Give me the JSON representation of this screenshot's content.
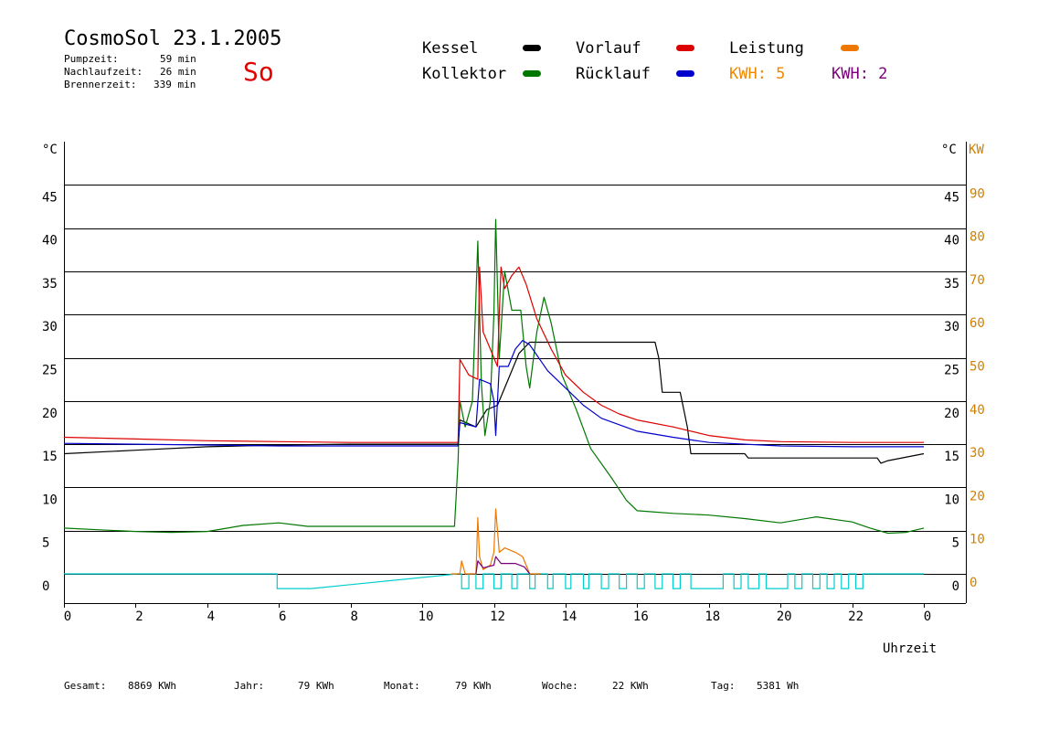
{
  "header": {
    "title": "CosmoSol 23.1.2005",
    "day": "So",
    "stats": [
      {
        "label": "Pumpzeit:",
        "value": "59 min"
      },
      {
        "label": "Nachlaufzeit:",
        "value": "26 min"
      },
      {
        "label": "Brennerzeit:",
        "value": "339 min"
      }
    ]
  },
  "legend": {
    "kessel": {
      "label": "Kessel",
      "color": "#000000"
    },
    "kollektor": {
      "label": "Kollektor",
      "color": "#007700"
    },
    "vorlauf": {
      "label": "Vorlauf",
      "color": "#dd0000"
    },
    "ruecklauf": {
      "label": "Rücklauf",
      "color": "#0000cc"
    },
    "leistung": {
      "label": "Leistung",
      "color": "#ee7700"
    },
    "kwh1": {
      "label": "KWH: 5",
      "color": "#ee8800"
    },
    "kwh2": {
      "label": "KWH: 2",
      "color": "#770077"
    }
  },
  "footer": {
    "gesamt": {
      "label": "Gesamt:",
      "value": "8869 KWh"
    },
    "jahr": {
      "label": "Jahr:",
      "value": "79 KWh"
    },
    "monat": {
      "label": "Monat:",
      "value": "79 KWh"
    },
    "woche": {
      "label": "Woche:",
      "value": "22 KWh"
    },
    "tag": {
      "label": "Tag:",
      "value": "5381 Wh"
    }
  },
  "chart_data": {
    "type": "line",
    "xlabel": "Uhrzeit",
    "ylabel_left": "°C",
    "ylabel_right": "°C",
    "ylabel_power": "KW",
    "xlim": [
      0,
      24
    ],
    "ylim": [
      0,
      50
    ],
    "x_ticks": [
      0,
      2,
      4,
      6,
      8,
      10,
      12,
      14,
      16,
      18,
      20,
      22,
      24
    ],
    "x_tick_labels": [
      "0",
      "2",
      "4",
      "6",
      "8",
      "10",
      "12",
      "14",
      "16",
      "18",
      "20",
      "22",
      "0"
    ],
    "y_ticks": [
      0,
      5,
      10,
      15,
      20,
      25,
      30,
      35,
      40,
      45
    ],
    "y_tick_labels": [
      "0",
      "5",
      "10",
      "15",
      "20",
      "25",
      "30",
      "35",
      "40",
      "45"
    ],
    "power_tick_labels": [
      "0",
      "10",
      "20",
      "30",
      "40",
      "50",
      "60",
      "70",
      "80",
      "90"
    ],
    "grid": "horizontal",
    "series": [
      {
        "name": "Kessel",
        "color": "#000000",
        "points": [
          [
            0,
            13.9
          ],
          [
            2,
            14.3
          ],
          [
            4,
            14.7
          ],
          [
            6,
            14.9
          ],
          [
            8,
            15.0
          ],
          [
            10,
            15.0
          ],
          [
            11.0,
            15.0
          ],
          [
            11.05,
            17.8
          ],
          [
            11.5,
            17.0
          ],
          [
            11.8,
            19.0
          ],
          [
            12.1,
            19.5
          ],
          [
            12.4,
            22.5
          ],
          [
            12.7,
            25.5
          ],
          [
            13.0,
            26.8
          ],
          [
            14,
            26.8
          ],
          [
            15,
            26.8
          ],
          [
            16,
            26.8
          ],
          [
            16.5,
            26.8
          ],
          [
            16.6,
            25.0
          ],
          [
            16.7,
            21.0
          ],
          [
            17.2,
            21.0
          ],
          [
            17.4,
            17.0
          ],
          [
            17.5,
            13.9
          ],
          [
            19,
            13.9
          ],
          [
            19.1,
            13.4
          ],
          [
            21,
            13.4
          ],
          [
            22.7,
            13.4
          ],
          [
            22.8,
            12.8
          ],
          [
            23,
            13.1
          ],
          [
            24,
            13.9
          ]
        ]
      },
      {
        "name": "Kollektor",
        "color": "#007700",
        "points": [
          [
            0,
            5.3
          ],
          [
            1,
            5.1
          ],
          [
            2,
            4.9
          ],
          [
            3,
            4.8
          ],
          [
            4,
            4.9
          ],
          [
            5,
            5.6
          ],
          [
            6,
            5.9
          ],
          [
            6.8,
            5.5
          ],
          [
            7,
            5.5
          ],
          [
            10,
            5.5
          ],
          [
            10.9,
            5.5
          ],
          [
            11.0,
            13.0
          ],
          [
            11.05,
            20.0
          ],
          [
            11.2,
            17.0
          ],
          [
            11.4,
            20.0
          ],
          [
            11.55,
            38.5
          ],
          [
            11.65,
            22.0
          ],
          [
            11.75,
            16.0
          ],
          [
            11.9,
            20.0
          ],
          [
            12.0,
            30.0
          ],
          [
            12.05,
            41.0
          ],
          [
            12.15,
            25.0
          ],
          [
            12.3,
            35.0
          ],
          [
            12.5,
            30.5
          ],
          [
            12.75,
            30.5
          ],
          [
            12.9,
            24.0
          ],
          [
            13.0,
            21.5
          ],
          [
            13.2,
            28.0
          ],
          [
            13.4,
            32.0
          ],
          [
            13.6,
            29.0
          ],
          [
            13.9,
            23.0
          ],
          [
            14.3,
            19.0
          ],
          [
            14.7,
            14.5
          ],
          [
            15.3,
            11.0
          ],
          [
            15.7,
            8.5
          ],
          [
            16.0,
            7.3
          ],
          [
            17,
            7.0
          ],
          [
            18,
            6.8
          ],
          [
            19,
            6.4
          ],
          [
            20,
            5.9
          ],
          [
            21,
            6.6
          ],
          [
            22,
            6.0
          ],
          [
            22.5,
            5.3
          ],
          [
            23,
            4.7
          ],
          [
            23.5,
            4.8
          ],
          [
            24,
            5.3
          ]
        ]
      },
      {
        "name": "Vorlauf",
        "color": "#dd0000",
        "points": [
          [
            0,
            15.8
          ],
          [
            2,
            15.6
          ],
          [
            4,
            15.4
          ],
          [
            6,
            15.3
          ],
          [
            8,
            15.2
          ],
          [
            10,
            15.2
          ],
          [
            11.0,
            15.2
          ],
          [
            11.05,
            24.8
          ],
          [
            11.3,
            23.0
          ],
          [
            11.55,
            22.5
          ],
          [
            11.6,
            35.5
          ],
          [
            11.7,
            28.0
          ],
          [
            11.9,
            26.0
          ],
          [
            12.1,
            24.0
          ],
          [
            12.2,
            35.5
          ],
          [
            12.3,
            33.0
          ],
          [
            12.5,
            34.5
          ],
          [
            12.7,
            35.5
          ],
          [
            12.9,
            33.5
          ],
          [
            13.2,
            29.5
          ],
          [
            13.6,
            26.0
          ],
          [
            14,
            23.0
          ],
          [
            14.5,
            21.0
          ],
          [
            15,
            19.5
          ],
          [
            15.5,
            18.5
          ],
          [
            16,
            17.8
          ],
          [
            17,
            17.0
          ],
          [
            18,
            16.0
          ],
          [
            19,
            15.5
          ],
          [
            20,
            15.3
          ],
          [
            22,
            15.2
          ],
          [
            24,
            15.2
          ]
        ]
      },
      {
        "name": "Rücklauf",
        "color": "#0000cc",
        "points": [
          [
            0,
            15.1
          ],
          [
            2,
            15.0
          ],
          [
            4,
            14.9
          ],
          [
            6,
            14.8
          ],
          [
            8,
            14.8
          ],
          [
            10,
            14.8
          ],
          [
            11.0,
            14.8
          ],
          [
            11.05,
            17.5
          ],
          [
            11.5,
            17.0
          ],
          [
            11.6,
            22.5
          ],
          [
            11.9,
            22.0
          ],
          [
            12.0,
            20.0
          ],
          [
            12.05,
            16.0
          ],
          [
            12.15,
            24.0
          ],
          [
            12.4,
            24.0
          ],
          [
            12.6,
            26.0
          ],
          [
            12.8,
            27.0
          ],
          [
            13.0,
            26.5
          ],
          [
            13.5,
            23.5
          ],
          [
            14,
            21.5
          ],
          [
            14.5,
            19.5
          ],
          [
            15,
            18.0
          ],
          [
            16,
            16.5
          ],
          [
            17,
            15.8
          ],
          [
            18,
            15.2
          ],
          [
            20,
            14.8
          ],
          [
            22,
            14.7
          ],
          [
            24,
            14.7
          ]
        ]
      },
      {
        "name": "Leistung",
        "color": "#ee7700",
        "points": [
          [
            10.8,
            0
          ],
          [
            11.05,
            0
          ],
          [
            11.1,
            1.5
          ],
          [
            11.2,
            0
          ],
          [
            11.5,
            0
          ],
          [
            11.55,
            6.5
          ],
          [
            11.6,
            2.0
          ],
          [
            11.7,
            0.5
          ],
          [
            11.9,
            1.0
          ],
          [
            12.0,
            2.5
          ],
          [
            12.05,
            7.5
          ],
          [
            12.15,
            2.5
          ],
          [
            12.3,
            3.0
          ],
          [
            12.6,
            2.5
          ],
          [
            12.8,
            2.0
          ],
          [
            13.0,
            0
          ],
          [
            13.3,
            0
          ]
        ]
      },
      {
        "name": "KWH",
        "color": "#770077",
        "points": [
          [
            11.5,
            0
          ],
          [
            11.55,
            1.5
          ],
          [
            11.7,
            0.7
          ],
          [
            12.0,
            1.0
          ],
          [
            12.05,
            2.0
          ],
          [
            12.2,
            1.2
          ],
          [
            12.6,
            1.2
          ],
          [
            12.85,
            0.8
          ],
          [
            13.0,
            0
          ]
        ]
      }
    ],
    "pump_series": {
      "color": "#00cccc",
      "points": [
        [
          0,
          0
        ],
        [
          5.95,
          0
        ],
        [
          5.95,
          -1.7
        ],
        [
          6.9,
          -1.7
        ],
        [
          11.0,
          0
        ],
        [
          11.1,
          0
        ],
        [
          11.1,
          -1.7
        ],
        [
          11.3,
          -1.7
        ],
        [
          11.3,
          0
        ],
        [
          11.5,
          0
        ],
        [
          11.5,
          -1.7
        ],
        [
          11.7,
          -1.7
        ],
        [
          11.7,
          0
        ],
        [
          12.0,
          0
        ],
        [
          12.0,
          -1.7
        ],
        [
          12.2,
          -1.7
        ],
        [
          12.2,
          0
        ],
        [
          12.5,
          0
        ],
        [
          12.5,
          -1.7
        ],
        [
          12.65,
          -1.7
        ],
        [
          12.65,
          0
        ],
        [
          13.0,
          0
        ],
        [
          13.0,
          -1.7
        ],
        [
          13.15,
          -1.7
        ],
        [
          13.15,
          0
        ],
        [
          13.5,
          0
        ],
        [
          13.5,
          -1.7
        ],
        [
          13.65,
          -1.7
        ],
        [
          13.65,
          0
        ],
        [
          14.0,
          0
        ],
        [
          14.0,
          -1.7
        ],
        [
          14.15,
          -1.7
        ],
        [
          14.15,
          0
        ],
        [
          14.5,
          0
        ],
        [
          14.5,
          -1.7
        ],
        [
          14.65,
          -1.7
        ],
        [
          14.65,
          0
        ],
        [
          15.0,
          0
        ],
        [
          15.0,
          -1.7
        ],
        [
          15.2,
          -1.7
        ],
        [
          15.2,
          0
        ],
        [
          15.5,
          0
        ],
        [
          15.5,
          -1.7
        ],
        [
          15.7,
          -1.7
        ],
        [
          15.7,
          0
        ],
        [
          16.0,
          0
        ],
        [
          16.0,
          -1.7
        ],
        [
          16.2,
          -1.7
        ],
        [
          16.2,
          0
        ],
        [
          16.5,
          0
        ],
        [
          16.5,
          -1.7
        ],
        [
          16.7,
          -1.7
        ],
        [
          16.7,
          0
        ],
        [
          17.0,
          0
        ],
        [
          17.0,
          -1.7
        ],
        [
          17.2,
          -1.7
        ],
        [
          17.2,
          0
        ],
        [
          17.5,
          0
        ],
        [
          17.5,
          -1.7
        ],
        [
          18.4,
          -1.7
        ],
        [
          18.4,
          0
        ],
        [
          18.7,
          0
        ],
        [
          18.7,
          -1.7
        ],
        [
          18.9,
          -1.7
        ],
        [
          18.9,
          0
        ],
        [
          19.1,
          0
        ],
        [
          19.1,
          -1.7
        ],
        [
          19.4,
          -1.7
        ],
        [
          19.4,
          0
        ],
        [
          19.6,
          0
        ],
        [
          19.6,
          -1.7
        ],
        [
          20.2,
          -1.7
        ],
        [
          20.2,
          0
        ],
        [
          20.4,
          0
        ],
        [
          20.4,
          -1.7
        ],
        [
          20.6,
          -1.7
        ],
        [
          20.6,
          0
        ],
        [
          20.9,
          0
        ],
        [
          20.9,
          -1.7
        ],
        [
          21.1,
          -1.7
        ],
        [
          21.1,
          0
        ],
        [
          21.3,
          0
        ],
        [
          21.3,
          -1.7
        ],
        [
          21.5,
          -1.7
        ],
        [
          21.5,
          0
        ],
        [
          21.7,
          0
        ],
        [
          21.7,
          -1.7
        ],
        [
          21.9,
          -1.7
        ],
        [
          21.9,
          0
        ],
        [
          22.1,
          0
        ],
        [
          22.1,
          -1.7
        ],
        [
          22.3,
          -1.7
        ],
        [
          22.3,
          0
        ],
        [
          24,
          0
        ]
      ]
    }
  }
}
